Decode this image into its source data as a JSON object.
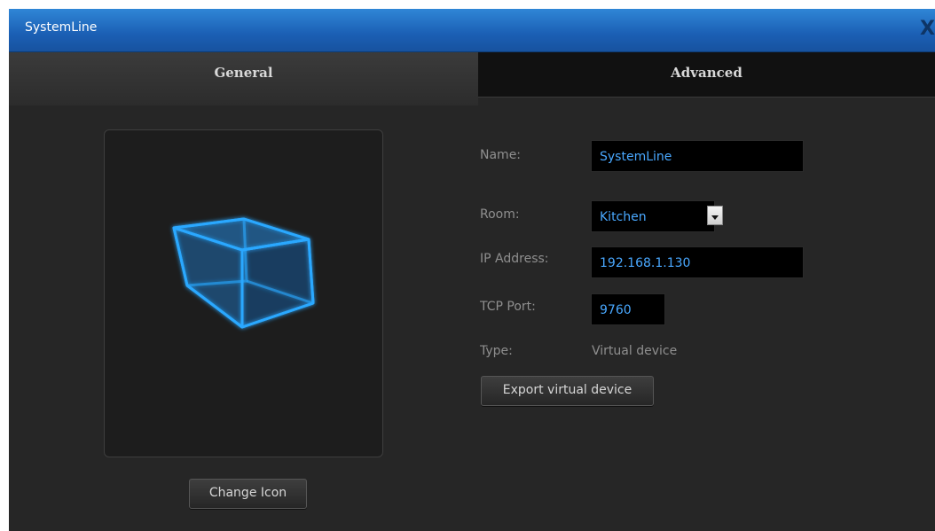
{
  "window": {
    "title": "SystemLine",
    "close_label": "X"
  },
  "tabs": [
    {
      "label": "General",
      "active": true
    },
    {
      "label": "Advanced",
      "active": false
    }
  ],
  "icon": {
    "name": "cube-icon",
    "color": "#2aa8ff",
    "change_label": "Change Icon"
  },
  "form": {
    "name_label": "Name:",
    "name_value": "SystemLine",
    "room_label": "Room:",
    "room_value": "Kitchen",
    "ip_label": "IP Address:",
    "ip_value": "192.168.1.130",
    "port_label": "TCP Port:",
    "port_value": "9760",
    "type_label": "Type:",
    "type_value": "Virtual device",
    "export_label": "Export virtual device"
  }
}
